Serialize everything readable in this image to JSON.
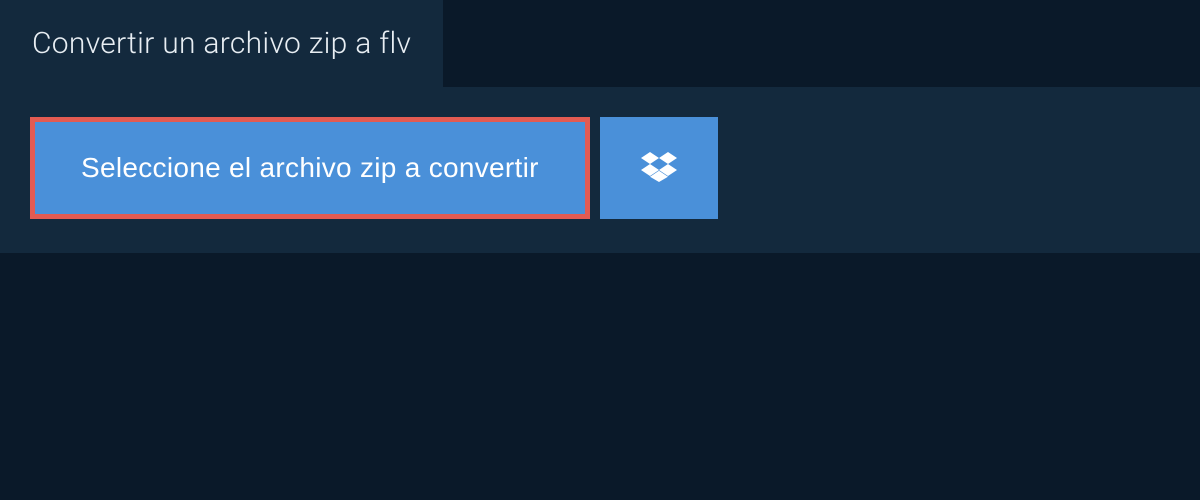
{
  "header": {
    "title": "Convertir un archivo zip a flv"
  },
  "actions": {
    "select_file_label": "Seleccione el archivo zip a convertir",
    "dropbox_icon_name": "dropbox-icon"
  },
  "colors": {
    "background": "#0a1929",
    "panel": "#13293d",
    "accent_blue": "#4a90d9",
    "highlight_border": "#e35b52",
    "text_light": "#e8eef3",
    "text_white": "#ffffff"
  }
}
